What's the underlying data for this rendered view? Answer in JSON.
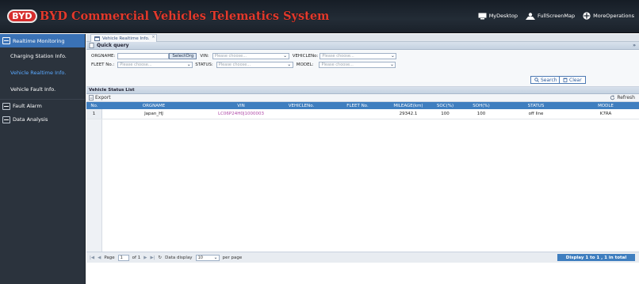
{
  "header": {
    "logo_text": "BYD",
    "title": "BYD Commercial Vehicles Telematics System",
    "links": [
      "MyDesktop",
      "FullScreenMap",
      "MoreOperations"
    ]
  },
  "sidebar": {
    "sections": [
      {
        "label": "Realtime Monitoring",
        "active": true,
        "items": [
          {
            "label": "Charging Station Info.",
            "active": false
          },
          {
            "label": "Vehicle Realtime Info.",
            "active": true
          },
          {
            "label": "Vehicle Fault Info.",
            "active": false
          }
        ]
      },
      {
        "label": "Fault Alarm",
        "active": false,
        "items": []
      },
      {
        "label": "Data Analysis",
        "active": false,
        "items": []
      }
    ]
  },
  "tab": {
    "label": "Vehicle Realtime Info.",
    "close": "×"
  },
  "quick_query": {
    "title": "Quick query",
    "collapse_icon": "»",
    "orgname_label": "ORGNAME:",
    "orgname_value": "",
    "selectorg_label": "SelectOrg",
    "vin_label": "VIN:",
    "vehicleno_label": "VEHICLENo:",
    "fleet_label": "FLEET No.:",
    "status_label": "STATUS:",
    "model_label": "MODEL:",
    "placeholder": "Please choose...",
    "search_label": "Search",
    "clear_label": "Clear"
  },
  "list": {
    "title": "Vehicle Status List",
    "export_label": "Export",
    "refresh_label": "Refresh",
    "columns": [
      "No.",
      "ORGNAME",
      "VIN",
      "VEHICLENo.",
      "FLEET No.",
      "MILEAGE(km)",
      "SOC(%)",
      "SOH(%)",
      "STATUS",
      "MODLE"
    ],
    "rows": [
      {
        "no": "1",
        "orgname": "Japan_HJ",
        "vin": "LC06P24H0J1000003",
        "vehicleno": "",
        "fleetno": "",
        "mileage": "29342.1",
        "soc": "100",
        "soh": "100",
        "status": "off line",
        "model": "K7RA"
      }
    ]
  },
  "pager": {
    "first": "|◀",
    "prev": "◀",
    "page_label": "Page",
    "page_value": "1",
    "of_label": "of 1",
    "next": "▶",
    "last": "▶|",
    "refresh": "↻",
    "display_label": "Data display",
    "page_size": "10",
    "per_page": "per page",
    "summary": "Display 1 to 1 , 1 in total"
  },
  "colors": {
    "accent": "#3f7ebf",
    "sidebar_bg": "#2b333d",
    "title_red": "#e33a2d",
    "active_blue": "#5aa9ff"
  }
}
